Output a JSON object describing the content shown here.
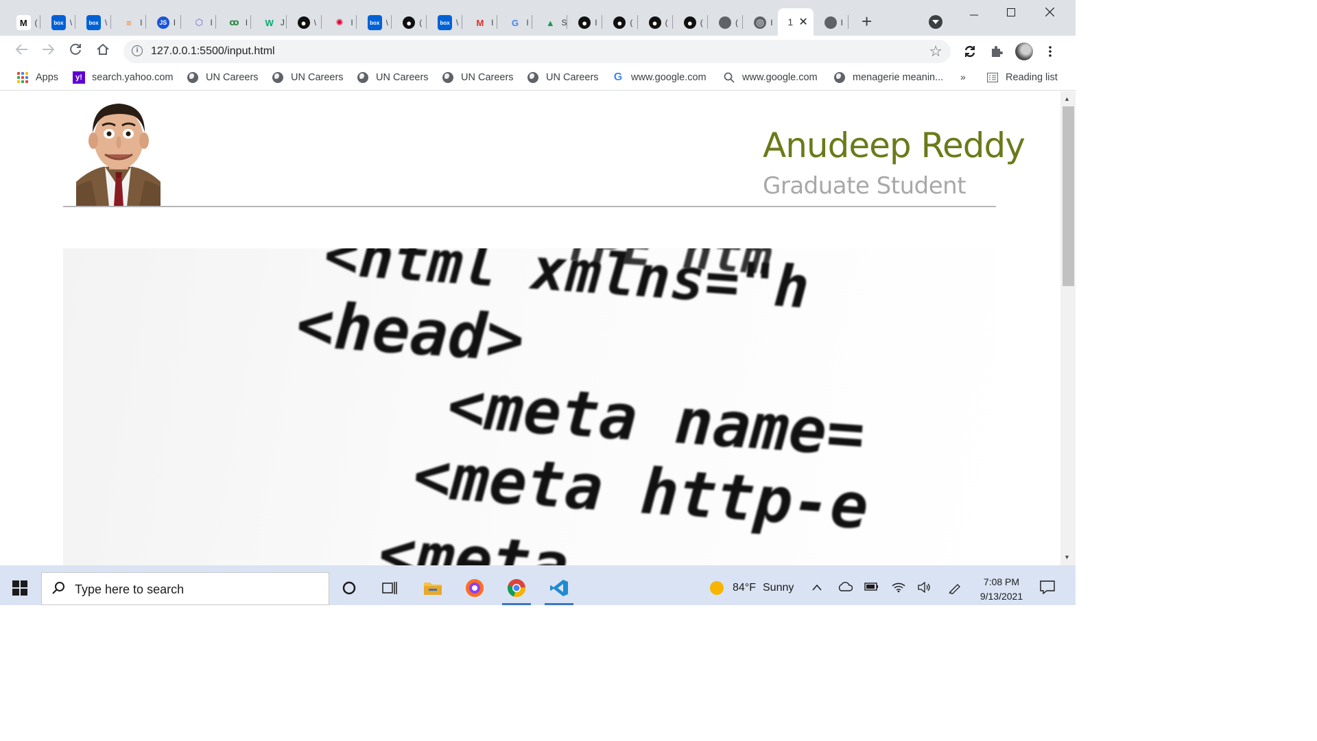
{
  "browser": {
    "tabs": [
      {
        "label": "(",
        "icon": "medium-icon"
      },
      {
        "label": "\\",
        "icon": "box-icon"
      },
      {
        "label": "\\",
        "icon": "box-icon"
      },
      {
        "label": "I",
        "icon": "stackoverflow-icon"
      },
      {
        "label": "I",
        "icon": "js-icon"
      },
      {
        "label": "I",
        "icon": "gear-hex-icon"
      },
      {
        "label": "I",
        "icon": "geeksforgeeks-icon"
      },
      {
        "label": "J",
        "icon": "w3schools-icon"
      },
      {
        "label": "\\",
        "icon": "github-icon"
      },
      {
        "label": "I",
        "icon": "angular-icon"
      },
      {
        "label": "\\",
        "icon": "box-icon"
      },
      {
        "label": "(",
        "icon": "github-icon"
      },
      {
        "label": "\\",
        "icon": "box-icon"
      },
      {
        "label": "I",
        "icon": "gmail-icon"
      },
      {
        "label": "I",
        "icon": "google-icon"
      },
      {
        "label": "S",
        "icon": "drive-icon"
      },
      {
        "label": "I",
        "icon": "github-icon"
      },
      {
        "label": "(",
        "icon": "github-icon"
      },
      {
        "label": "(",
        "icon": "github-icon"
      },
      {
        "label": "(",
        "icon": "github-icon"
      },
      {
        "label": "(",
        "icon": "globe-icon"
      },
      {
        "label": "I",
        "icon": "chrome-icon"
      },
      {
        "label": "1",
        "icon": "none",
        "active": true
      },
      {
        "label": "I",
        "icon": "globe-icon"
      }
    ],
    "new_tab_label": "+",
    "url": "127.0.0.1:5500/input.html",
    "bookmarks": [
      {
        "label": "Apps",
        "icon": "apps-grid-icon"
      },
      {
        "label": "search.yahoo.com",
        "icon": "yahoo-icon"
      },
      {
        "label": "UN Careers",
        "icon": "globe-icon"
      },
      {
        "label": "UN Careers",
        "icon": "globe-icon"
      },
      {
        "label": "UN Careers",
        "icon": "globe-icon"
      },
      {
        "label": "UN Careers",
        "icon": "globe-icon"
      },
      {
        "label": "UN Careers",
        "icon": "globe-icon"
      },
      {
        "label": "www.google.com",
        "icon": "google-icon"
      },
      {
        "label": "www.google.com",
        "icon": "search-icon"
      },
      {
        "label": "menagerie meanin...",
        "icon": "globe-icon"
      }
    ],
    "bookmarks_overflow": "»",
    "reading_list": "Reading list"
  },
  "page": {
    "name": "Anudeep Reddy",
    "title": "Graduate Student",
    "banner_lines": [
      "<html  xmlns=\"h",
      "<head>",
      "<meta  name=",
      "<meta  http-e",
      "<meta"
    ],
    "banner_top_fragment": "YPE  htm"
  },
  "taskbar": {
    "search_placeholder": "Type here to search",
    "weather_temp": "84°F",
    "weather_text": "Sunny",
    "time": "7:08 PM",
    "date": "9/13/2021"
  },
  "colors": {
    "name_color": "#6b7a18",
    "title_color": "#a8a8a8",
    "tabstrip_bg": "#dee1e6",
    "taskbar_bg": "#d9e3f3"
  }
}
